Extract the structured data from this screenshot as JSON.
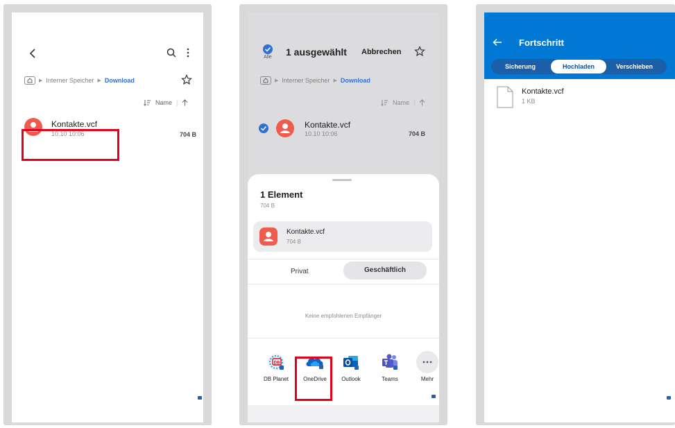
{
  "screen1": {
    "breadcrumb": {
      "storage": "Interner Speicher",
      "folder": "Download"
    },
    "sort_label": "Name",
    "file": {
      "name": "Kontakte.vcf",
      "date": "10.10 10:06",
      "size": "704 B"
    }
  },
  "screen2": {
    "selected_text": "1 ausgewählt",
    "all_label": "Alle",
    "cancel_label": "Abbrechen",
    "breadcrumb": {
      "storage": "Interner Speicher",
      "folder": "Download"
    },
    "sort_label": "Name",
    "file": {
      "name": "Kontakte.vcf",
      "date": "10.10 10:06",
      "size": "704 B"
    },
    "sheet": {
      "title": "1 Element",
      "size": "704 B",
      "file": {
        "name": "Kontakte.vcf",
        "size": "704 B"
      },
      "tabs": [
        "Privat",
        "Geschäftlich"
      ],
      "empty_text": "Keine empfohlenen Empfänger",
      "apps": [
        "DB Planet",
        "OneDrive",
        "Outlook",
        "Teams",
        "Mehr"
      ]
    }
  },
  "screen3": {
    "title": "Fortschritt",
    "tabs": [
      "Sicherung",
      "Hochladen",
      "Verschieben"
    ],
    "file": {
      "name": "Kontakte.vcf",
      "size": "1 KB"
    }
  },
  "colors": {
    "accent_blue": "#0078d4",
    "highlight_red": "#e3001b",
    "contact_red": "#ef5b4c",
    "link_blue": "#2f6fd6"
  }
}
